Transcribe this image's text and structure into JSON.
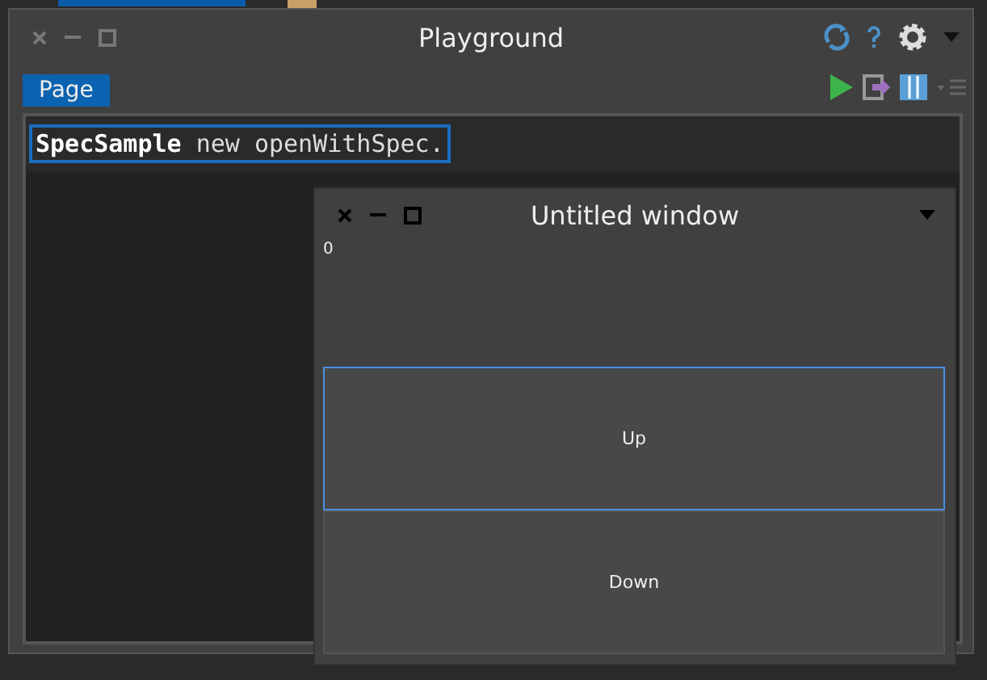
{
  "playground": {
    "title": "Playground",
    "tabs": [
      {
        "label": "Page",
        "selected": true
      }
    ],
    "code": "**SpecSample** new openWithSpec."
  },
  "untitled_window": {
    "title": "Untitled window",
    "counter": "0",
    "buttons": [
      {
        "label": "Up",
        "focused": true
      },
      {
        "label": "Down",
        "focused": false
      }
    ]
  }
}
